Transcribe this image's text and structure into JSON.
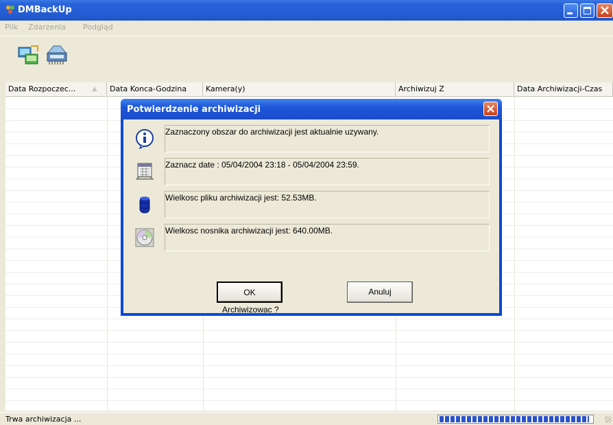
{
  "window": {
    "title": "DMBackUp"
  },
  "menu": [
    "Plik",
    "Zdarzenia",
    "Podgląd"
  ],
  "toolbar": {
    "tools": [
      "network-backup-icon",
      "tape-drive-icon"
    ]
  },
  "table": {
    "columns": [
      "Data Rozpoczec...",
      "Data Konca-Godzina",
      "Kamera(y)",
      "Archiwizuj Z",
      "Data Archiwizacji-Czas"
    ]
  },
  "dialog": {
    "title": "Potwierdzenie archiwizacji",
    "messages": [
      {
        "icon": "info-icon",
        "text": "Zaznaczony obszar do archiwizacji jest aktualnie uzywany."
      },
      {
        "icon": "calendar-icon",
        "text": "Zaznacz date : 05/04/2004 23:18 - 05/04/2004 23:59."
      },
      {
        "icon": "storage-cylinder-icon",
        "text": "Wielkosc pliku archiwizacji jest: 52.53MB."
      },
      {
        "icon": "cd-icon",
        "text": "Wielkosc nosnika archiwizacji jest: 640.00MB."
      }
    ],
    "question": "Archiwizowac ?",
    "ok_label": "OK",
    "cancel_label": "Anuluj"
  },
  "status": {
    "text": "Trwa archiwizacja ...",
    "progress": 0.98
  },
  "colors": {
    "titlebar": "#245ed6",
    "progress": "#2a53c9",
    "face": "#ece9d8"
  }
}
